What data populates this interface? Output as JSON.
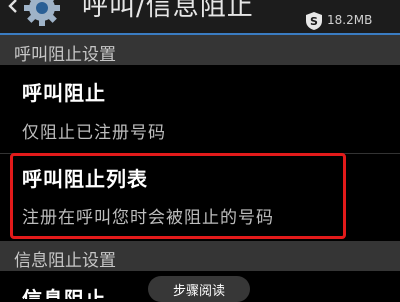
{
  "action_bar": {
    "title": "呼叫/信息阻止",
    "storage": "18.2MB",
    "shield_letter": "S"
  },
  "sections": [
    {
      "header": "呼叫阻止设置",
      "items": [
        {
          "title": "呼叫阻止",
          "subtitle": "仅阻止已注册号码"
        },
        {
          "title": "呼叫阻止列表",
          "subtitle": "注册在呼叫您时会被阻止的号码"
        }
      ]
    },
    {
      "header": "信息阻止设置",
      "items": [
        {
          "title": "信息阻止"
        }
      ]
    }
  ],
  "overlay": {
    "step_read_label": "步骤阅读"
  },
  "colors": {
    "accent": "#3a7cc2",
    "highlight": "#e21a1a"
  }
}
